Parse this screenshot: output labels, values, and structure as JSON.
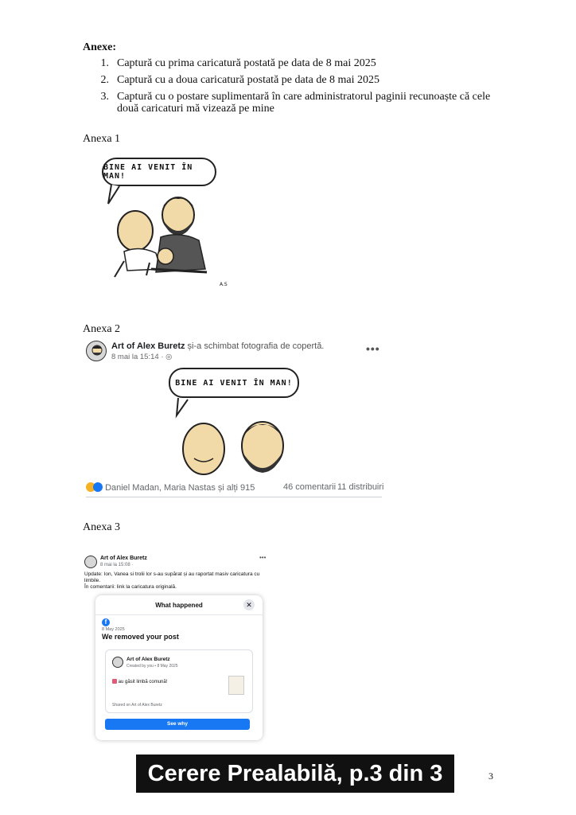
{
  "heading": "Anexe:",
  "annexes": [
    {
      "num": "1.",
      "text": "Captură cu prima caricatură postată pe data de 8 mai 2025"
    },
    {
      "num": "2.",
      "text": "Captură cu a doua caricatură postată pe data de 8 mai 2025"
    },
    {
      "num": "3.",
      "text": "Captură cu o postare suplimentară în care administratorul paginii recunoaște că cele două caricaturi mă vizează pe mine"
    }
  ],
  "annex1": {
    "label": "Anexa 1",
    "bubble_text": "BINE AI VENIT ÎN MAN!",
    "signature": "A.S"
  },
  "annex2": {
    "label": "Anexa 2",
    "author": "Art of Alex Buretz",
    "action": " și-a schimbat fotografia de copertă.",
    "time": "8 mai la 15:14 · ",
    "more": "•••",
    "bubble_text": "BINE AI VENIT ÎN MAN!",
    "reactions": "Daniel Madan, Maria Nastas și alți 915",
    "comments": "46 comentarii",
    "shares": "11 distribuiri"
  },
  "annex3": {
    "label": "Anexa 3",
    "author": "Art of Alex Buretz",
    "time": "8 mai la 15:08 · ",
    "more": "•••",
    "update_text": "Update: Ion, Vanea si trolii lor s-au supărat și au raportat masiv caricatura cu limbile.",
    "comment_text": "În comentarii: link la caricatura originală.",
    "dialog": {
      "title": "What happened",
      "date": "8 May 2025",
      "headline": "We removed your post",
      "card_author": "Art of Alex Buretz",
      "card_meta": "Created by you • 8 May 2025",
      "card_text": "au găsit limbă comună!",
      "card_footer": "Shared on Art of Alex Buretz",
      "button": "See why"
    }
  },
  "footer": "Cerere Prealabilă, p.3 din 3",
  "page_number": "3",
  "colors": {
    "fb_blue": "#1877f2",
    "like_blue": "#1877f2",
    "haha_yellow": "#f7b125"
  }
}
